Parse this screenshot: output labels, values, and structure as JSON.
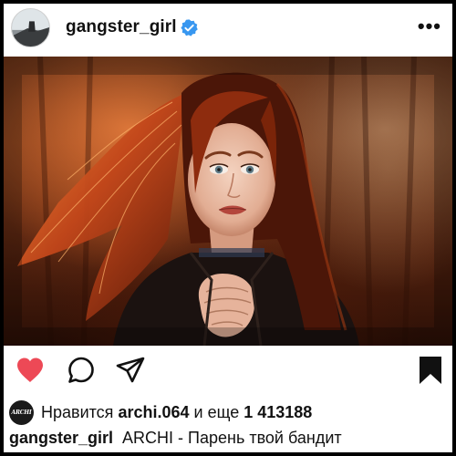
{
  "post": {
    "username": "gangster_girl",
    "verified": true,
    "more_label": "•••"
  },
  "photo": {
    "description_colors": {
      "hair": "#c2461a",
      "background": "#6a2d14",
      "coat": "#1b1210"
    }
  },
  "actions": {
    "like_icon": "heart-icon",
    "like_color": "#ed4956",
    "comment_icon": "comment-icon",
    "share_icon": "share-icon",
    "save_icon": "bookmark-icon"
  },
  "likes": {
    "avatar_label": "ARCHI",
    "prefix": "Нравится",
    "liker": "archi.064",
    "connector": "и еще",
    "count": "1 413188"
  },
  "caption": {
    "username": "gangster_girl",
    "text": "ARCHI - Парень твой бандит"
  }
}
